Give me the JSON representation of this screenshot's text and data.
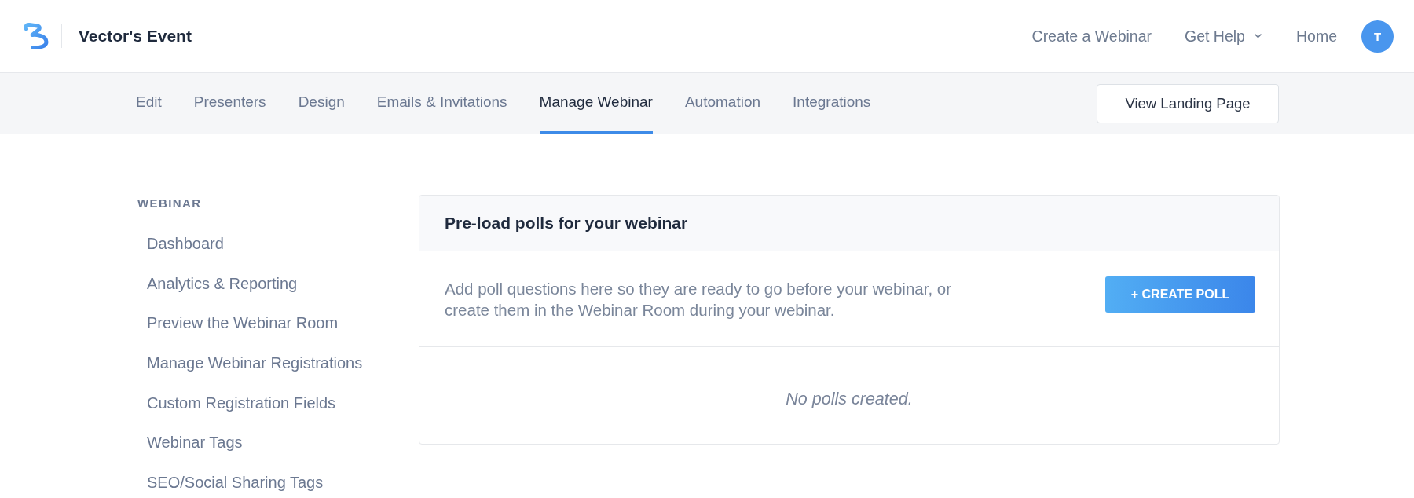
{
  "header": {
    "title": "Vector's Event",
    "nav": [
      {
        "label": "Create a Webinar",
        "kind": "link"
      },
      {
        "label": "Get Help",
        "kind": "dropdown"
      },
      {
        "label": "Home",
        "kind": "link"
      }
    ],
    "avatar": {
      "initial": "T"
    }
  },
  "tabs": [
    {
      "label": "Edit",
      "selected": false
    },
    {
      "label": "Presenters",
      "selected": false
    },
    {
      "label": "Design",
      "selected": false
    },
    {
      "label": "Emails & Invitations",
      "selected": false
    },
    {
      "label": "Manage Webinar",
      "selected": true
    },
    {
      "label": "Automation",
      "selected": false
    },
    {
      "label": "Integrations",
      "selected": false
    }
  ],
  "view_button": {
    "label": "View Landing Page"
  },
  "sidebar": {
    "heading": "WEBINAR",
    "items": [
      "Dashboard",
      "Analytics & Reporting",
      "Preview the Webinar Room",
      "Manage Webinar Registrations",
      "Custom Registration Fields",
      "Webinar Tags",
      "SEO/Social Sharing Tags"
    ]
  },
  "card": {
    "title": "Pre-load polls for your webinar",
    "description": "Add poll questions here so they are ready to go before your webinar, or create them in the Webinar Room during your webinar.",
    "button": "+ CREATE POLL",
    "empty_message": "No polls created."
  }
}
